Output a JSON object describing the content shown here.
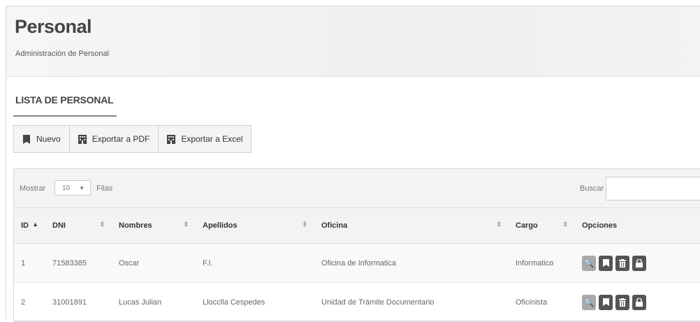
{
  "header": {
    "title": "Personal",
    "subtitle": "Administración de Personal"
  },
  "section": {
    "title": "LISTA DE PERSONAL"
  },
  "toolbar": {
    "new_label": "Nuevo",
    "pdf_label": "Exportar a PDF",
    "excel_label": "Exportar a Excel"
  },
  "controls": {
    "show_label": "Mostrar",
    "page_size": "10",
    "rows_label": "Filas",
    "search_label": "Buscar",
    "search_value": ""
  },
  "table": {
    "columns": [
      "ID",
      "DNI",
      "Nombres",
      "Apellidos",
      "Oficina",
      "Cargo",
      "Opciones"
    ],
    "rows": [
      {
        "id": "1",
        "dni": "71583385",
        "nombres": "Oscar",
        "apellidos": "F.I.",
        "oficina": "Oficina de Informatica",
        "cargo": "Informatico"
      },
      {
        "id": "2",
        "dni": "31001891",
        "nombres": "Lucas Julian",
        "apellidos": "Llocclla Cespedes",
        "oficina": "Unidad de Trámite Documentario",
        "cargo": "Oficinista"
      }
    ]
  },
  "icons": {
    "bookmark": "bookmark-icon",
    "building": "building-icon",
    "search": "search-icon",
    "trash": "trash-icon",
    "lock": "lock-icon"
  },
  "colors": {
    "option_dark": "#555555",
    "option_light": "#a9a9a9"
  }
}
